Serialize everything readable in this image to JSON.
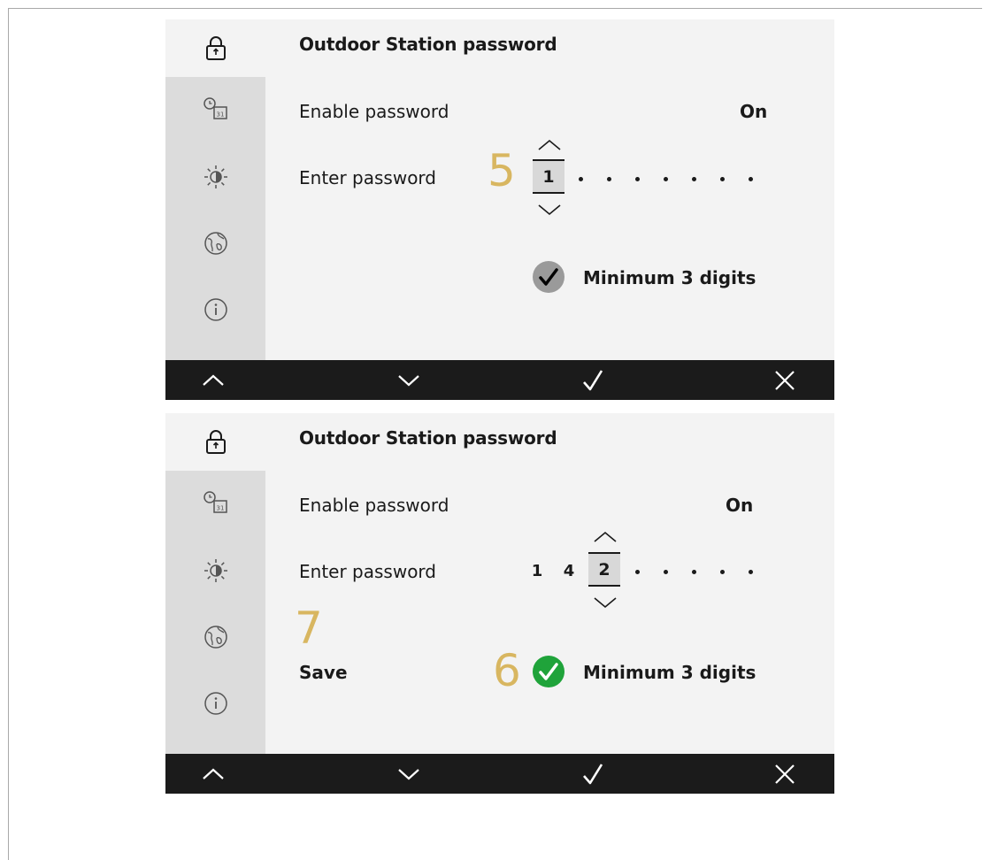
{
  "screens": [
    {
      "title": "Outdoor Station password",
      "enable_label": "Enable password",
      "enable_value": "On",
      "enter_label": "Enter password",
      "password": {
        "entered": [],
        "current": "1",
        "remaining_slots": 7
      },
      "hint": "Minimum 3 digits",
      "hint_state": "unmet",
      "callout": "5"
    },
    {
      "title": "Outdoor Station password",
      "enable_label": "Enable password",
      "enable_value": "On",
      "enter_label": "Enter password",
      "password": {
        "entered": [
          "1",
          "4"
        ],
        "current": "2",
        "remaining_slots": 5
      },
      "save_label": "Save",
      "hint": "Minimum 3 digits",
      "hint_state": "met",
      "callout_save": "7",
      "callout_hint": "6"
    }
  ],
  "sidebar_icons": [
    "lock-icon",
    "clock-calendar-icon",
    "brightness-icon",
    "globe-icon",
    "info-icon"
  ],
  "toolbar_icons": [
    "chevron-up-icon",
    "chevron-down-icon",
    "checkmark-icon",
    "close-icon"
  ],
  "colors": {
    "callout": "#d8b660",
    "check_met": "#1fa33a",
    "check_unmet": "#9a9a9a",
    "toolbar": "#1b1b1b"
  }
}
